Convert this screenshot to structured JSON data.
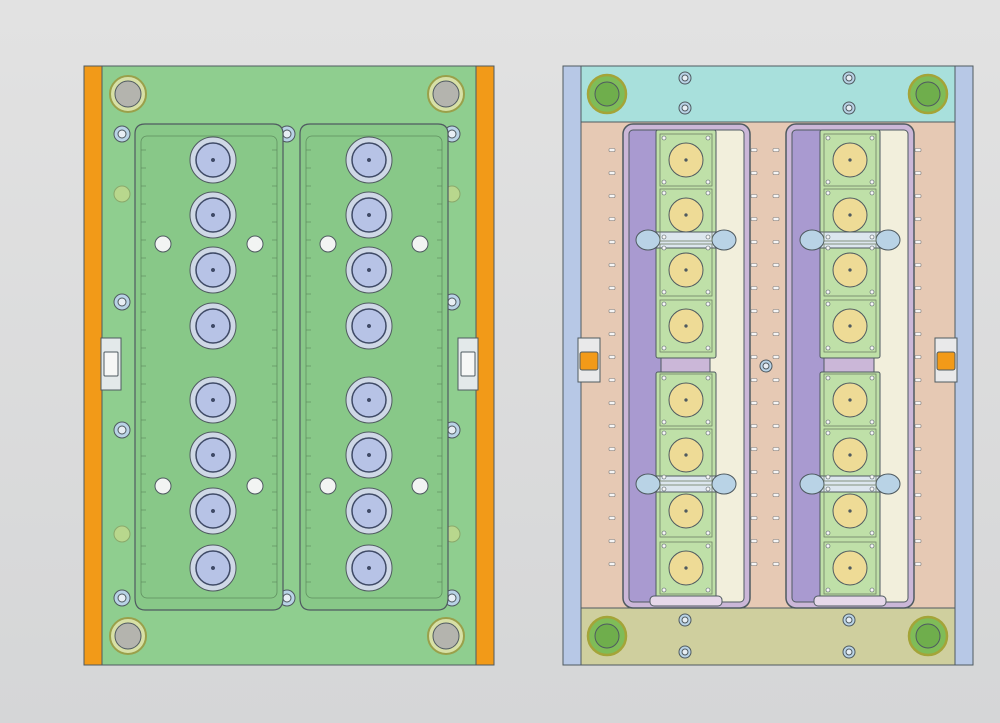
{
  "view": {
    "background_top": "#e2e2e2",
    "background_bottom": "#d5d6d7",
    "outline": "#4f5a60"
  },
  "cavity_plate": {
    "plate_color": "#8fce8f",
    "strip_color": "#f29a18",
    "pocket_color": "#88c888",
    "insert_outer_color": "#cfd8e6",
    "insert_inner_color": "#b7c3e6",
    "guide_bushing_color": "#d7e0a6",
    "guide_pin_color": "#b4b4ae",
    "water_plug_color": "#b9d3e6",
    "cavity_rows_per_pocket": 8
  },
  "core_plate": {
    "top_clamp_color": "#a8e0dc",
    "bottom_clamp_color": "#cfcf9e",
    "side_rail_color": "#b7c8e6",
    "body_color": "#e6c9b4",
    "slider_color": "#a99ad0",
    "wedge_color": "#f2efdc",
    "core_block_color": "#bfe0a8",
    "core_pin_color": "#eedb96",
    "guide_bushing_color": "#7fbc58",
    "core_rows_per_pocket": 8
  }
}
